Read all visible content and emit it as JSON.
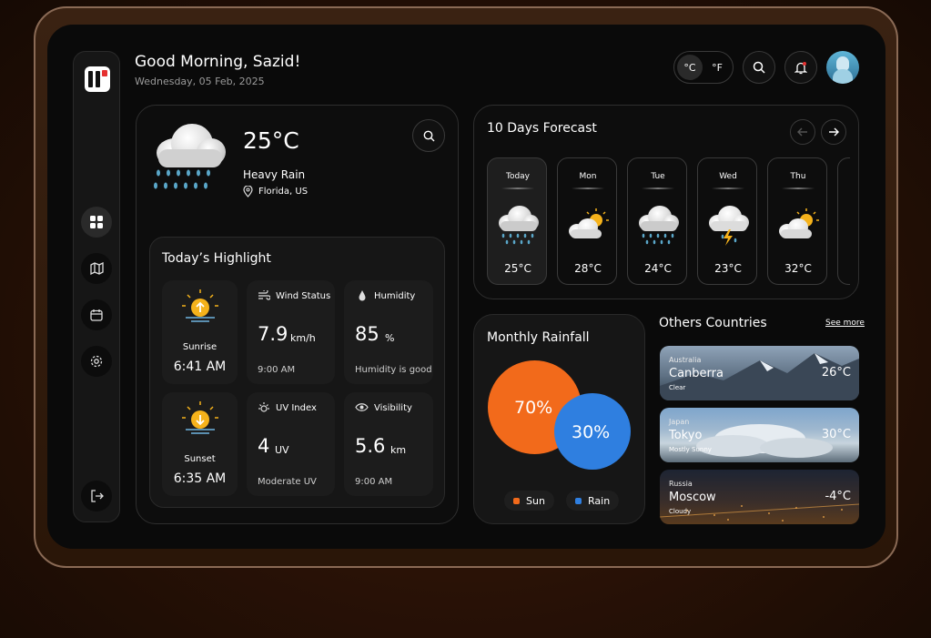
{
  "header": {
    "greeting": "Good Morning, Sazid!",
    "date": "Wednesday, 05 Feb, 2025",
    "unit_c": "°C",
    "unit_f": "°F"
  },
  "sidebar": {
    "logo_text": "UI",
    "items": [
      "dashboard",
      "map",
      "calendar",
      "settings"
    ],
    "logout": "logout"
  },
  "current": {
    "temp": "25°C",
    "condition": "Heavy Rain",
    "location": "Florida, US"
  },
  "highlight": {
    "title": "Today’s Highlight",
    "sunrise_label": "Sunrise",
    "sunrise_time": "6:41 AM",
    "sunset_label": "Sunset",
    "sunset_time": "6:35 AM",
    "wind_label": "Wind Status",
    "wind_value": "7.9",
    "wind_unit": "km/h",
    "wind_time": "9:00 AM",
    "humidity_label": "Humidity",
    "humidity_value": "85",
    "humidity_unit": "%",
    "humidity_note": "Humidity is good",
    "uv_label": "UV Index",
    "uv_value": "4",
    "uv_unit": "UV",
    "uv_note": "Moderate UV",
    "visibility_label": "Visibility",
    "visibility_value": "5.6",
    "visibility_unit": "km",
    "visibility_time": "9:00 AM"
  },
  "forecast": {
    "title": "10 Days Forecast",
    "days": [
      {
        "day": "Today",
        "temp": "25°C",
        "icon": "rain-cloud-icon"
      },
      {
        "day": "Mon",
        "temp": "28°C",
        "icon": "partly-sunny-icon"
      },
      {
        "day": "Tue",
        "temp": "24°C",
        "icon": "rain-cloud-icon"
      },
      {
        "day": "Wed",
        "temp": "23°C",
        "icon": "thunder-cloud-icon"
      },
      {
        "day": "Thu",
        "temp": "32°C",
        "icon": "partly-sunny-icon"
      }
    ]
  },
  "rainfall": {
    "title": "Monthly Rainfall",
    "sun_pct": "70%",
    "rain_pct": "30%",
    "sun_label": "Sun",
    "rain_label": "Rain",
    "sun_color": "#f26a1b",
    "rain_color": "#2f7fe0"
  },
  "countries": {
    "title": "Others Countries",
    "see_more": "See more",
    "items": [
      {
        "country": "Australia",
        "city": "Canberra",
        "condition": "Clear",
        "temp": "26°C"
      },
      {
        "country": "Japan",
        "city": "Tokyo",
        "condition": "Mostly Sunny",
        "temp": "30°C"
      },
      {
        "country": "Russia",
        "city": "Moscow",
        "condition": "Cloudy",
        "temp": "-4°C"
      }
    ]
  }
}
